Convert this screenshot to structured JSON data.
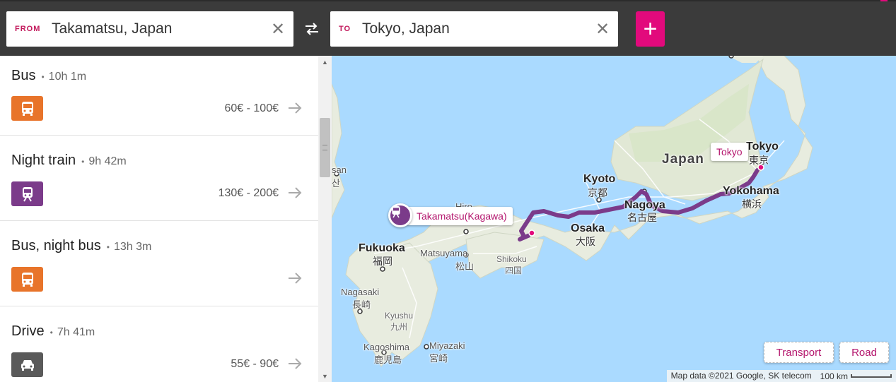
{
  "search": {
    "from_tag": "FROM",
    "from_value": "Takamatsu, Japan",
    "to_tag": "TO",
    "to_value": "Tokyo, Japan",
    "clear_glyph": "✕",
    "add_glyph": "+"
  },
  "routes": [
    {
      "title": "Bus",
      "duration": "10h 1m",
      "price": "60€ - 100€",
      "mode": "bus-icon",
      "color": "#e8742a"
    },
    {
      "title": "Night train",
      "duration": "9h 42m",
      "price": "130€ - 200€",
      "mode": "train-icon",
      "color": "#7b3b8a"
    },
    {
      "title": "Bus, night bus",
      "duration": "13h 3m",
      "price": "",
      "mode": "bus-icon",
      "color": "#e8742a"
    },
    {
      "title": "Drive",
      "duration": "7h 41m",
      "price": "55€ - 90€",
      "mode": "car-icon",
      "color": "#5a5a5a"
    }
  ],
  "map": {
    "labels": {
      "japan": "Japan",
      "kyoto": "Kyoto",
      "kyoto_jp": "京都",
      "osaka": "Osaka",
      "osaka_jp": "大阪",
      "nagoya": "Nagoya",
      "nagoya_jp": "名古屋",
      "yokohama": "Yokohama",
      "yokohama_jp": "横浜",
      "tokyo_en": "Tokyo",
      "tokyo_jp": "東京",
      "fukuoka": "Fukuoka",
      "fukuoka_jp": "福岡",
      "matsuyama": "Matsuyama",
      "matsuyama_jp": "松山",
      "shikoku": "Shikoku",
      "shikoku_jp": "四国",
      "nagasaki": "Nagasaki",
      "nagasaki_jp": "長崎",
      "kyushu": "Kyushu",
      "kyushu_jp": "九州",
      "kagoshima": "Kagoshima",
      "kagoshima_jp": "鹿児島",
      "miyazaki": "Miyazaki",
      "miyazaki_jp": "宮崎",
      "hiroshima_partial": "Hiro",
      "busan_partial": "san",
      "busan_partial_jp": "산"
    },
    "origin_callout": "Takamatsu(Kagawa)",
    "destination_callout": "Tokyo",
    "transport_button": "Transport",
    "road_button": "Road",
    "attribution": "Map data ©2021 Google, SK telecom",
    "scale_label": "100 km",
    "route_color": "#7b3b8a",
    "accent_color": "#e20a7c"
  }
}
